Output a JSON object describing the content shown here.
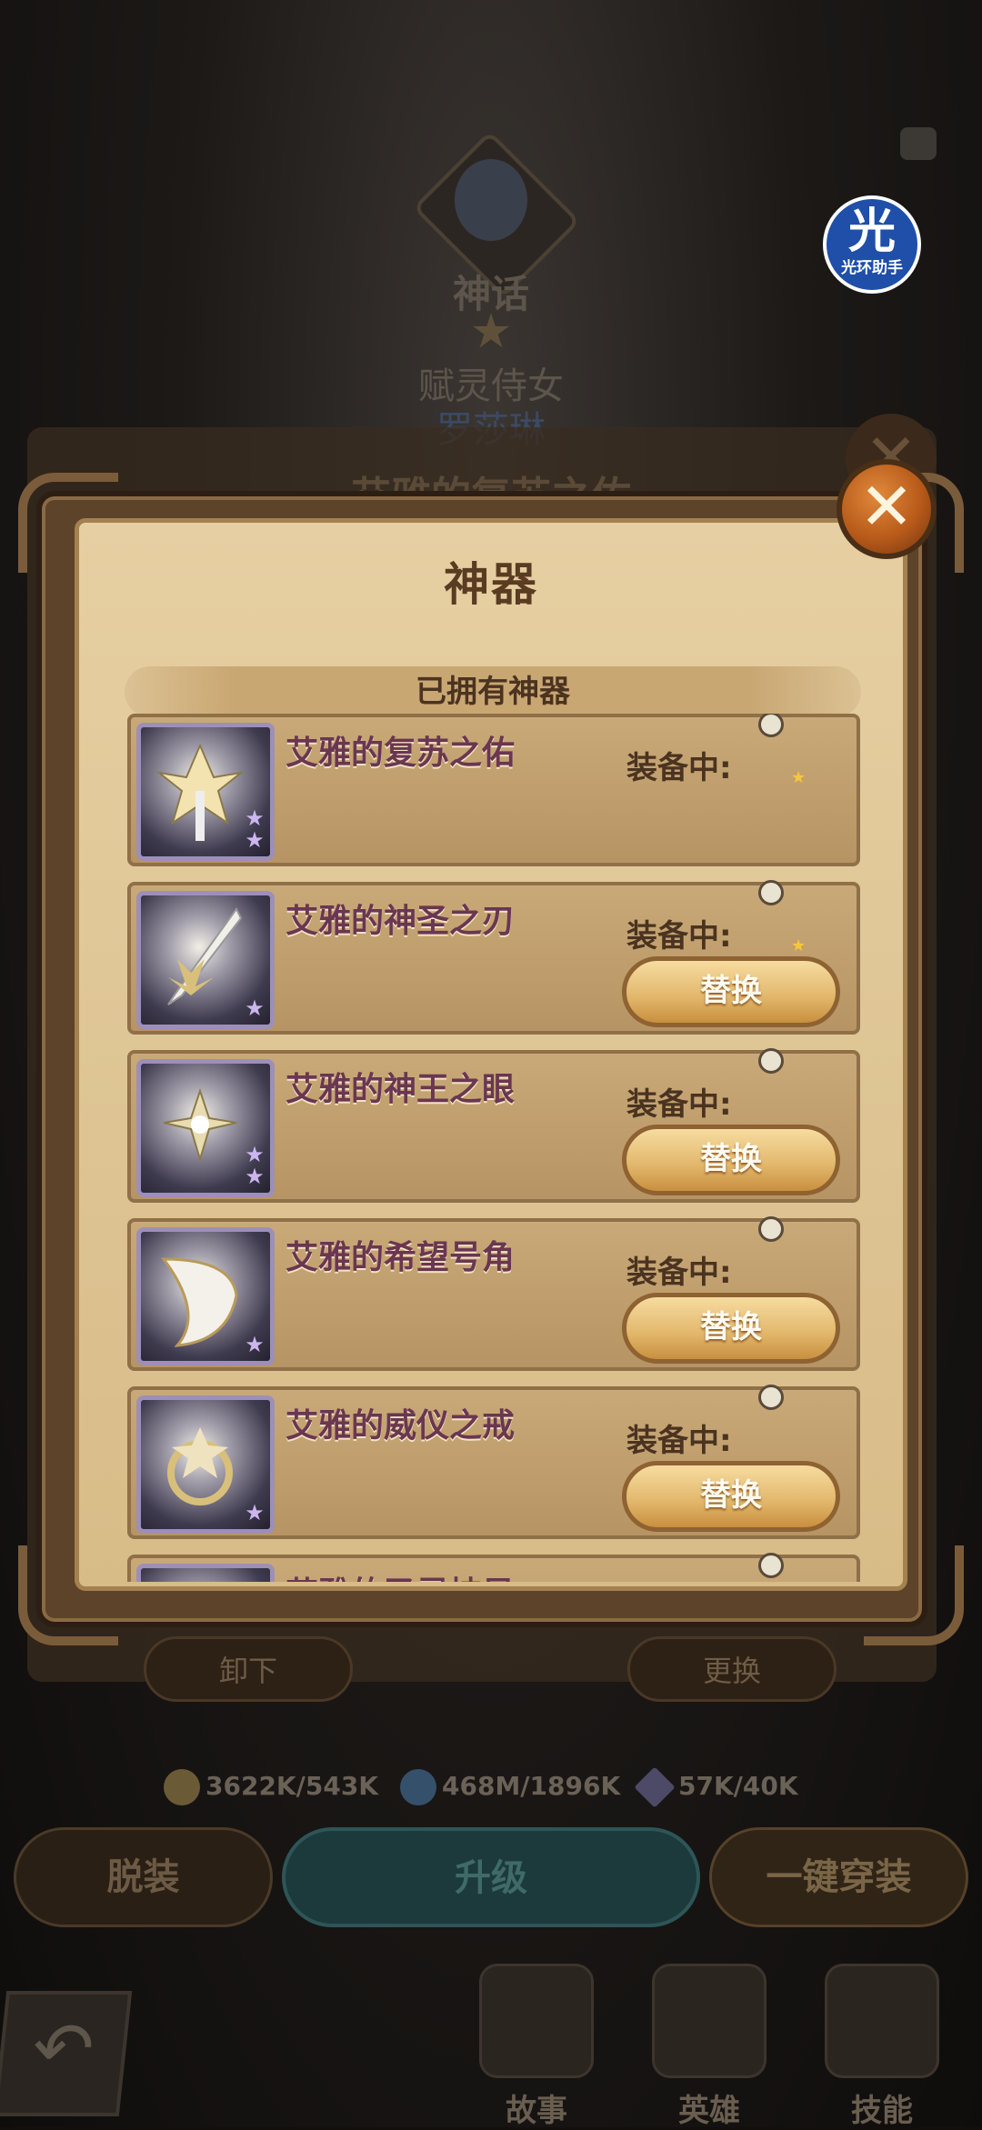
{
  "helper_badge": {
    "glyph": "光",
    "text": "光环助手"
  },
  "background": {
    "rarity": "神话",
    "role": "赋灵侍女",
    "hero_name": "罗莎琳",
    "old_title": "艾雅的复苏之佑",
    "unequip_label": "卸下",
    "swap_label": "更换",
    "resources": [
      {
        "icon": "gold-coin-icon",
        "value": "3622K/543K",
        "color": "#6b5a36"
      },
      {
        "icon": "hero-essence-icon",
        "value": "468M/1896K",
        "color": "#35506b"
      },
      {
        "icon": "crystal-icon",
        "value": "57K/40K",
        "color": "#4c4a66"
      }
    ],
    "strip_label": "脱装",
    "upgrade_label": "升级",
    "quick_equip_label": "一键穿装",
    "nav": [
      "故事",
      "英雄",
      "技能"
    ]
  },
  "modal": {
    "title": "神器",
    "close_glyph": "✕",
    "section_title": "已拥有神器",
    "equip_label": "装备中:",
    "replace_label": "替换",
    "items": [
      {
        "name": "艾雅的复苏之佑",
        "stars": 2,
        "hero_hair": "#e7d08a",
        "has_replace": false
      },
      {
        "name": "艾雅的神圣之刃",
        "stars": 1,
        "hero_hair": "#566a55",
        "has_replace": true
      },
      {
        "name": "艾雅的神王之眼",
        "stars": 2,
        "hero_hair": "#c9c2b4",
        "has_replace": true
      },
      {
        "name": "艾雅的希望号角",
        "stars": 1,
        "hero_hair": "#b33c2c",
        "has_replace": true
      },
      {
        "name": "艾雅的威仪之戒",
        "stars": 1,
        "hero_hair": "#e3c98e",
        "has_replace": true
      },
      {
        "name": "艾雅的圣灵披风",
        "stars": 1,
        "hero_hair": "#d49a3a",
        "has_replace": false
      }
    ]
  }
}
